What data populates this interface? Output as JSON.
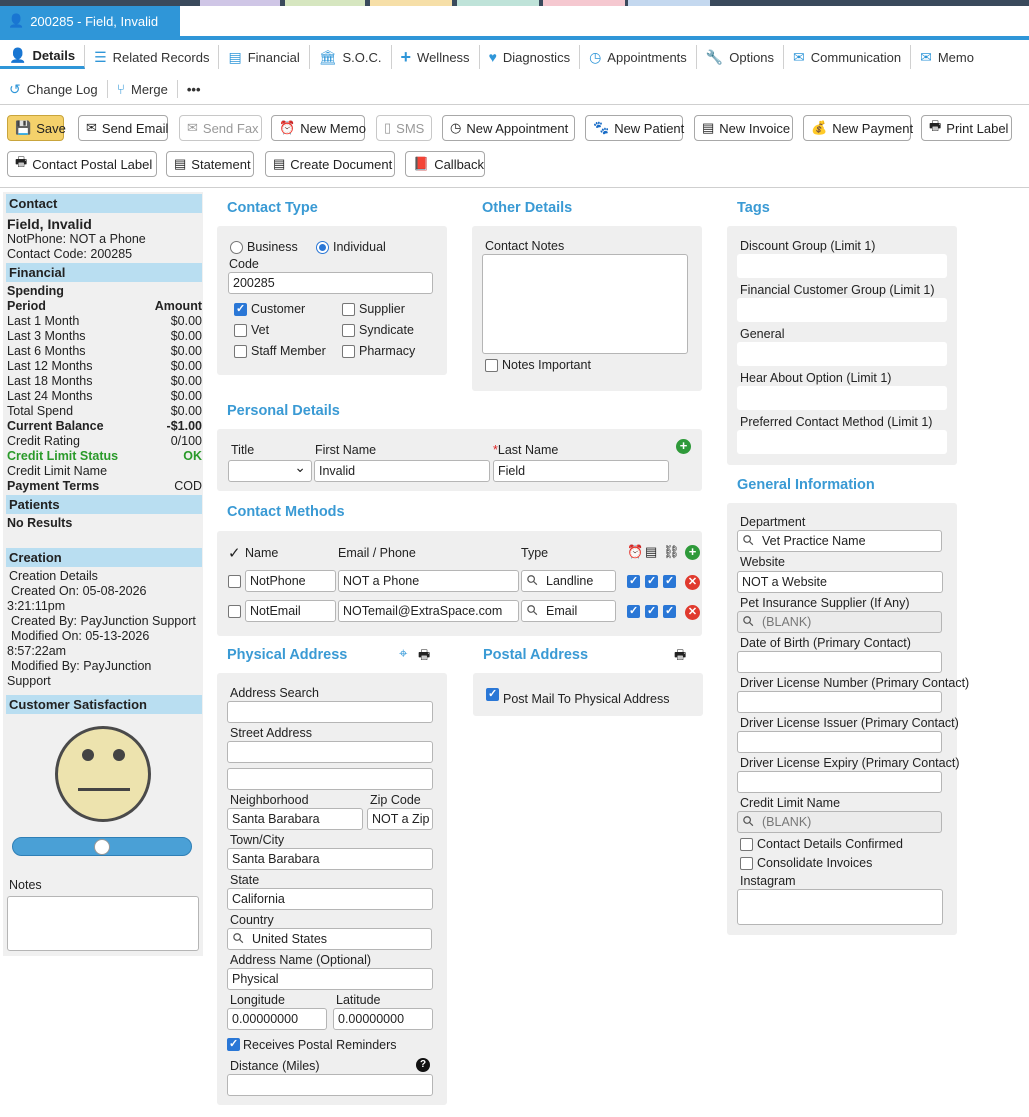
{
  "window": {
    "title": "200285 - Field, Invalid"
  },
  "colors": {
    "accent": "#2f96d8",
    "save": "#f4d16b",
    "section_title": "#3a9ad4",
    "sidebar_head": "#b9def1",
    "credit_ok": "#2a9a2a",
    "delete": "#e03a2e",
    "add": "#2f9a3a"
  },
  "nav": {
    "tabs": [
      {
        "label": "Details",
        "icon": "person-icon"
      },
      {
        "label": "Related Records",
        "icon": "list-icon"
      },
      {
        "label": "Financial",
        "icon": "ledger-icon"
      },
      {
        "label": "S.O.C.",
        "icon": "bank-icon"
      },
      {
        "label": "Wellness",
        "icon": "plus-icon"
      },
      {
        "label": "Diagnostics",
        "icon": "heart-icon"
      },
      {
        "label": "Appointments",
        "icon": "clock-icon"
      },
      {
        "label": "Options",
        "icon": "wrench-icon"
      },
      {
        "label": "Communication",
        "icon": "envelope-icon"
      },
      {
        "label": "Memo",
        "icon": "envelope-icon"
      }
    ]
  },
  "subnav": {
    "change_log": "Change Log",
    "merge": "Merge",
    "more": "•••"
  },
  "toolbar": {
    "save": "Save",
    "send_email": "Send Email",
    "send_fax": "Send Fax",
    "new_memo": "New Memo",
    "sms": "SMS",
    "new_appointment": "New Appointment",
    "new_patient": "New Patient",
    "new_invoice": "New Invoice",
    "new_payment": "New Payment",
    "print_label": "Print Label",
    "contact_postal_label": "Contact Postal Label",
    "statement": "Statement",
    "create_document": "Create Document",
    "callback": "Callback"
  },
  "sidebar": {
    "contact_head": "Contact",
    "name": "Field, Invalid",
    "phone": "NotPhone: NOT a Phone",
    "code": "Contact Code: 200285",
    "financial_head": "Financial",
    "spending": "Spending",
    "period": "Period",
    "amount": "Amount",
    "rows": [
      {
        "label": "Last 1 Month",
        "value": "$0.00"
      },
      {
        "label": "Last 3 Months",
        "value": "$0.00"
      },
      {
        "label": "Last 6 Months",
        "value": "$0.00"
      },
      {
        "label": "Last 12 Months",
        "value": "$0.00"
      },
      {
        "label": "Last 18 Months",
        "value": "$0.00"
      },
      {
        "label": "Last 24 Months",
        "value": "$0.00"
      },
      {
        "label": "Total Spend",
        "value": "$0.00"
      }
    ],
    "current_balance": "Current Balance",
    "current_balance_value": "-$1.00",
    "credit_rating": "Credit Rating",
    "credit_rating_value": "0/100",
    "credit_limit_status": "Credit Limit Status",
    "credit_limit_status_value": "OK",
    "credit_limit_name": "Credit Limit Name",
    "payment_terms": "Payment Terms",
    "payment_terms_value": "COD",
    "patients_head": "Patients",
    "no_results": "No Results",
    "creation_head": "Creation",
    "creation_details": "Creation Details",
    "created_on": "Created On: 05-08-2026",
    "created_time": "3:21:11pm",
    "created_by": "Created By: PayJunction Support",
    "modified_on": "Modified On: 05-13-2026",
    "modified_time": "8:57:22am",
    "modified_by": "Modified By: PayJunction",
    "modified_by2": "Support",
    "satisfaction_head": "Customer Satisfaction",
    "satisfaction_level": 0.5,
    "notes": "Notes"
  },
  "contact_type": {
    "title": "Contact Type",
    "business": "Business",
    "individual": "Individual",
    "code_label": "Code",
    "code": "200285",
    "customer": "Customer",
    "supplier": "Supplier",
    "vet": "Vet",
    "syndicate": "Syndicate",
    "staff": "Staff Member",
    "pharmacy": "Pharmacy"
  },
  "other_details": {
    "title": "Other Details",
    "contact_notes": "Contact Notes",
    "notes_important": "Notes Important"
  },
  "personal": {
    "title": "Personal Details",
    "title_label": "Title",
    "first_name_label": "First Name",
    "last_name_label": "Last Name",
    "required": "*",
    "first_name": "Invalid",
    "last_name": "Field"
  },
  "contact_methods": {
    "title": "Contact Methods",
    "name_col": "Name",
    "email_phone_col": "Email / Phone",
    "type_col": "Type",
    "rows": [
      {
        "name": "NotPhone",
        "value": "NOT a Phone",
        "type": "Landline"
      },
      {
        "name": "NotEmail",
        "value": "NOTemail@ExtraSpace.com",
        "type": "Email"
      }
    ]
  },
  "physical": {
    "title": "Physical Address",
    "address_search": "Address Search",
    "street_address": "Street Address",
    "neighborhood_label": "Neighborhood",
    "neighborhood": "Santa Barabara",
    "zip_label": "Zip Code",
    "zip": "NOT a Zip",
    "town_label": "Town/City",
    "town": "Santa Barabara",
    "state_label": "State",
    "state": "California",
    "country_label": "Country",
    "country": "United States",
    "address_name_label": "Address Name (Optional)",
    "address_name": "Physical",
    "longitude_label": "Longitude",
    "longitude": "0.00000000",
    "latitude_label": "Latitude",
    "latitude": "0.00000000",
    "receives_postal": "Receives Postal Reminders",
    "distance_label": "Distance (Miles)"
  },
  "postal": {
    "title": "Postal Address",
    "post_mail": "Post Mail To Physical Address"
  },
  "tags": {
    "title": "Tags",
    "groups": [
      "Discount Group (Limit 1)",
      "Financial Customer Group (Limit 1)",
      "General",
      "Hear About Option (Limit 1)",
      "Preferred Contact Method (Limit 1)"
    ]
  },
  "general": {
    "title": "General Information",
    "department_label": "Department",
    "department": "Vet Practice Name",
    "website_label": "Website",
    "website": "NOT a Website",
    "pet_insurance_label": "Pet Insurance Supplier (If Any)",
    "blank": "(BLANK)",
    "dob_label": "Date of Birth (Primary Contact)",
    "dl_number_label": "Driver License Number (Primary Contact)",
    "dl_issuer_label": "Driver License Issuer (Primary Contact)",
    "dl_expiry_label": "Driver License Expiry (Primary Contact)",
    "credit_limit_name_label": "Credit Limit Name",
    "contact_confirmed": "Contact Details Confirmed",
    "consolidate": "Consolidate Invoices",
    "instagram": "Instagram"
  }
}
